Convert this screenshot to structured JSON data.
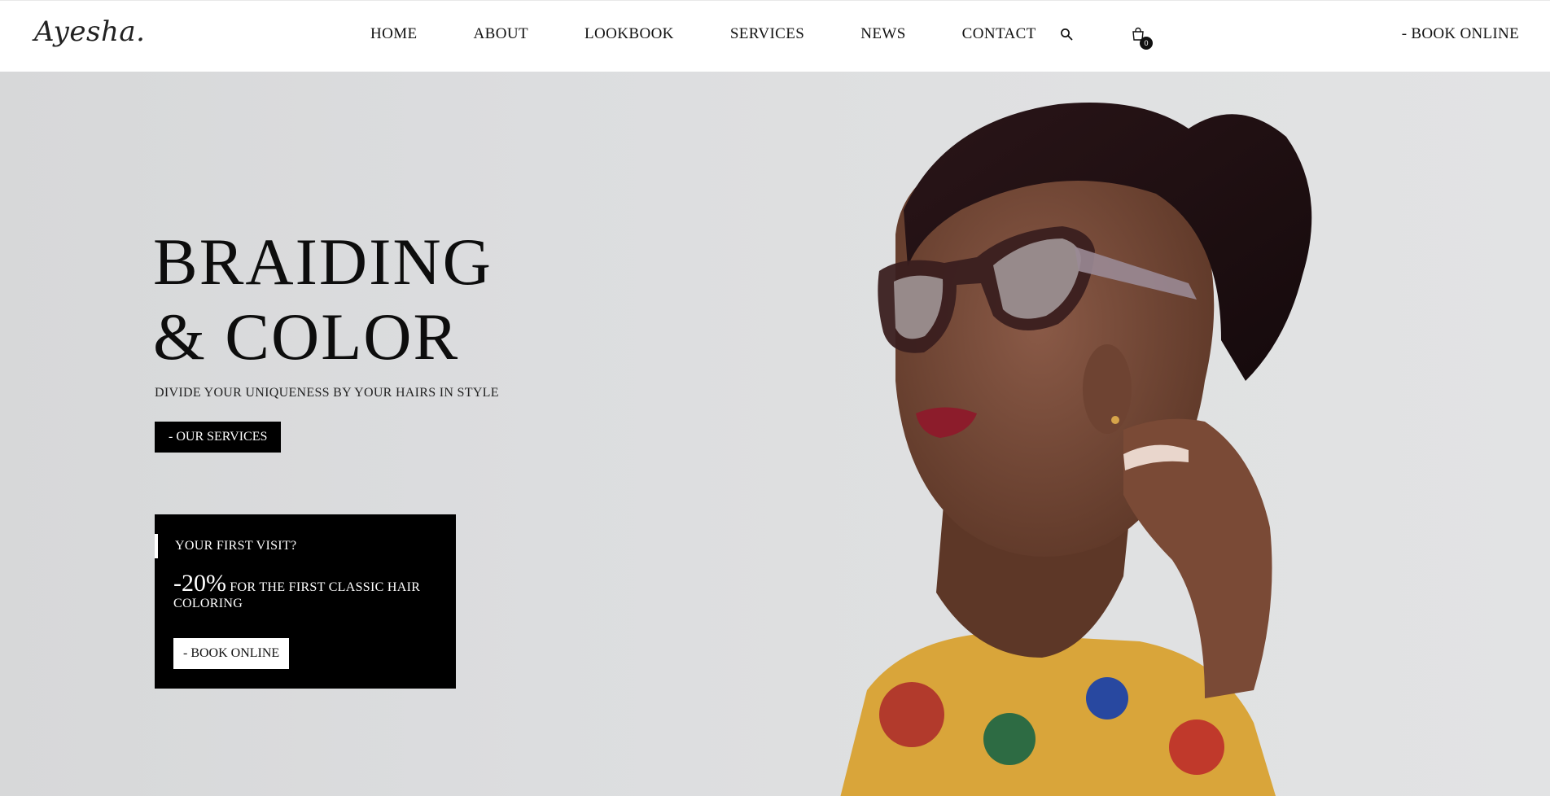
{
  "header": {
    "logo": "Ayesha.",
    "nav": [
      "HOME",
      "ABOUT",
      "LOOKBOOK",
      "SERVICES",
      "NEWS",
      "CONTACT"
    ],
    "cart_count": "0",
    "book_online": "- BOOK ONLINE"
  },
  "hero": {
    "headline_line1": "BRAIDING",
    "headline_line2": "& COLOR",
    "subline": "DIVIDE YOUR UNIQUENESS BY YOUR HAIRS IN STYLE",
    "services_button": "- OUR SERVICES"
  },
  "promo": {
    "label": "YOUR FIRST VISIT?",
    "discount": "-20%",
    "text": " FOR THE FIRST CLASSIC HAIR COLORING",
    "button": "- BOOK ONLINE"
  },
  "icons": {
    "search": "search-icon",
    "cart": "shopping-bag-icon"
  },
  "colors": {
    "primary": "#000000",
    "hero_background": "#dcdddf",
    "text": "#111111"
  }
}
